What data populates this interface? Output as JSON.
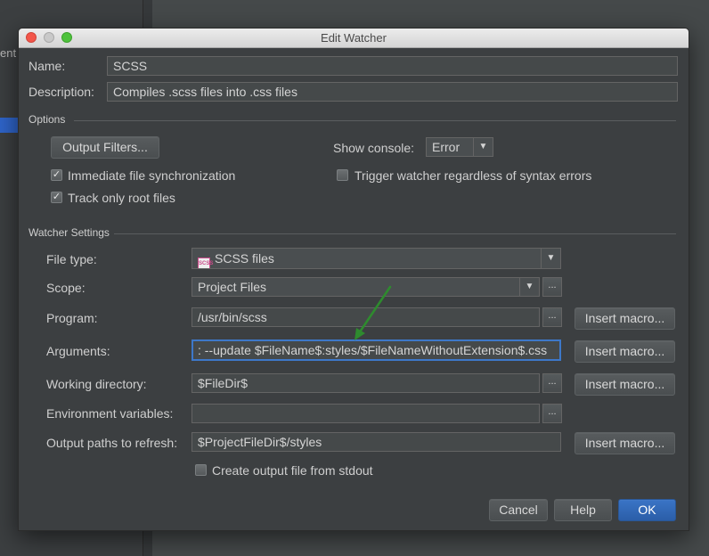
{
  "background": {
    "partial_text": "ent"
  },
  "dialog": {
    "title": "Edit Watcher",
    "name_label": "Name:",
    "name_value": "SCSS",
    "description_label": "Description:",
    "description_value": "Compiles .scss files into .css files"
  },
  "options": {
    "section_title": "Options",
    "output_filters_label": "Output Filters...",
    "show_console_label": "Show console:",
    "show_console_value": "Error",
    "immediate_sync_label": "Immediate file synchronization",
    "immediate_sync_checked": true,
    "track_root_label": "Track only root files",
    "track_root_checked": true,
    "trigger_watcher_label": "Trigger watcher regardless of syntax errors",
    "trigger_watcher_checked": false
  },
  "watcher_settings": {
    "section_title": "Watcher Settings",
    "file_type_label": "File type:",
    "file_type_icon_text": "SCSS",
    "file_type_value": "SCSS files",
    "scope_label": "Scope:",
    "scope_value": "Project Files",
    "program_label": "Program:",
    "program_value": "/usr/bin/scss",
    "arguments_label": "Arguments:",
    "arguments_value": ": --update $FileName$:styles/$FileNameWithoutExtension$.css",
    "working_dir_label": "Working directory:",
    "working_dir_value": "$FileDir$",
    "env_vars_label": "Environment variables:",
    "env_vars_value": "",
    "output_paths_label": "Output paths to refresh:",
    "output_paths_value": "$ProjectFileDir$/styles",
    "insert_macro_label": "Insert macro...",
    "browse_label": "...",
    "create_output_label": "Create output file from stdout",
    "create_output_checked": false
  },
  "buttons": {
    "cancel": "Cancel",
    "help": "Help",
    "ok": "OK"
  },
  "colors": {
    "dialog_bg": "#3c3f41",
    "accent": "#3d78c9",
    "annotation_arrow": "#2e8b2e"
  }
}
